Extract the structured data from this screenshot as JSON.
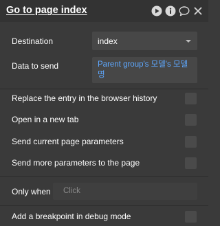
{
  "header": {
    "title": "Go to page index",
    "icons": [
      "play-icon",
      "info-icon",
      "comment-icon",
      "close-icon"
    ]
  },
  "destination": {
    "label": "Destination",
    "value": "index"
  },
  "data_to_send": {
    "label": "Data to send",
    "value": "Parent group's 모델's 모델명"
  },
  "options": [
    {
      "label": "Replace the entry in the browser history",
      "checked": false
    },
    {
      "label": "Open in a new tab",
      "checked": false
    },
    {
      "label": "Send current page parameters",
      "checked": false
    },
    {
      "label": "Send more parameters to the page",
      "checked": false
    }
  ],
  "only_when": {
    "label": "Only when",
    "placeholder": "Click"
  },
  "breakpoint": {
    "label": "Add a breakpoint in debug mode",
    "checked": false
  }
}
